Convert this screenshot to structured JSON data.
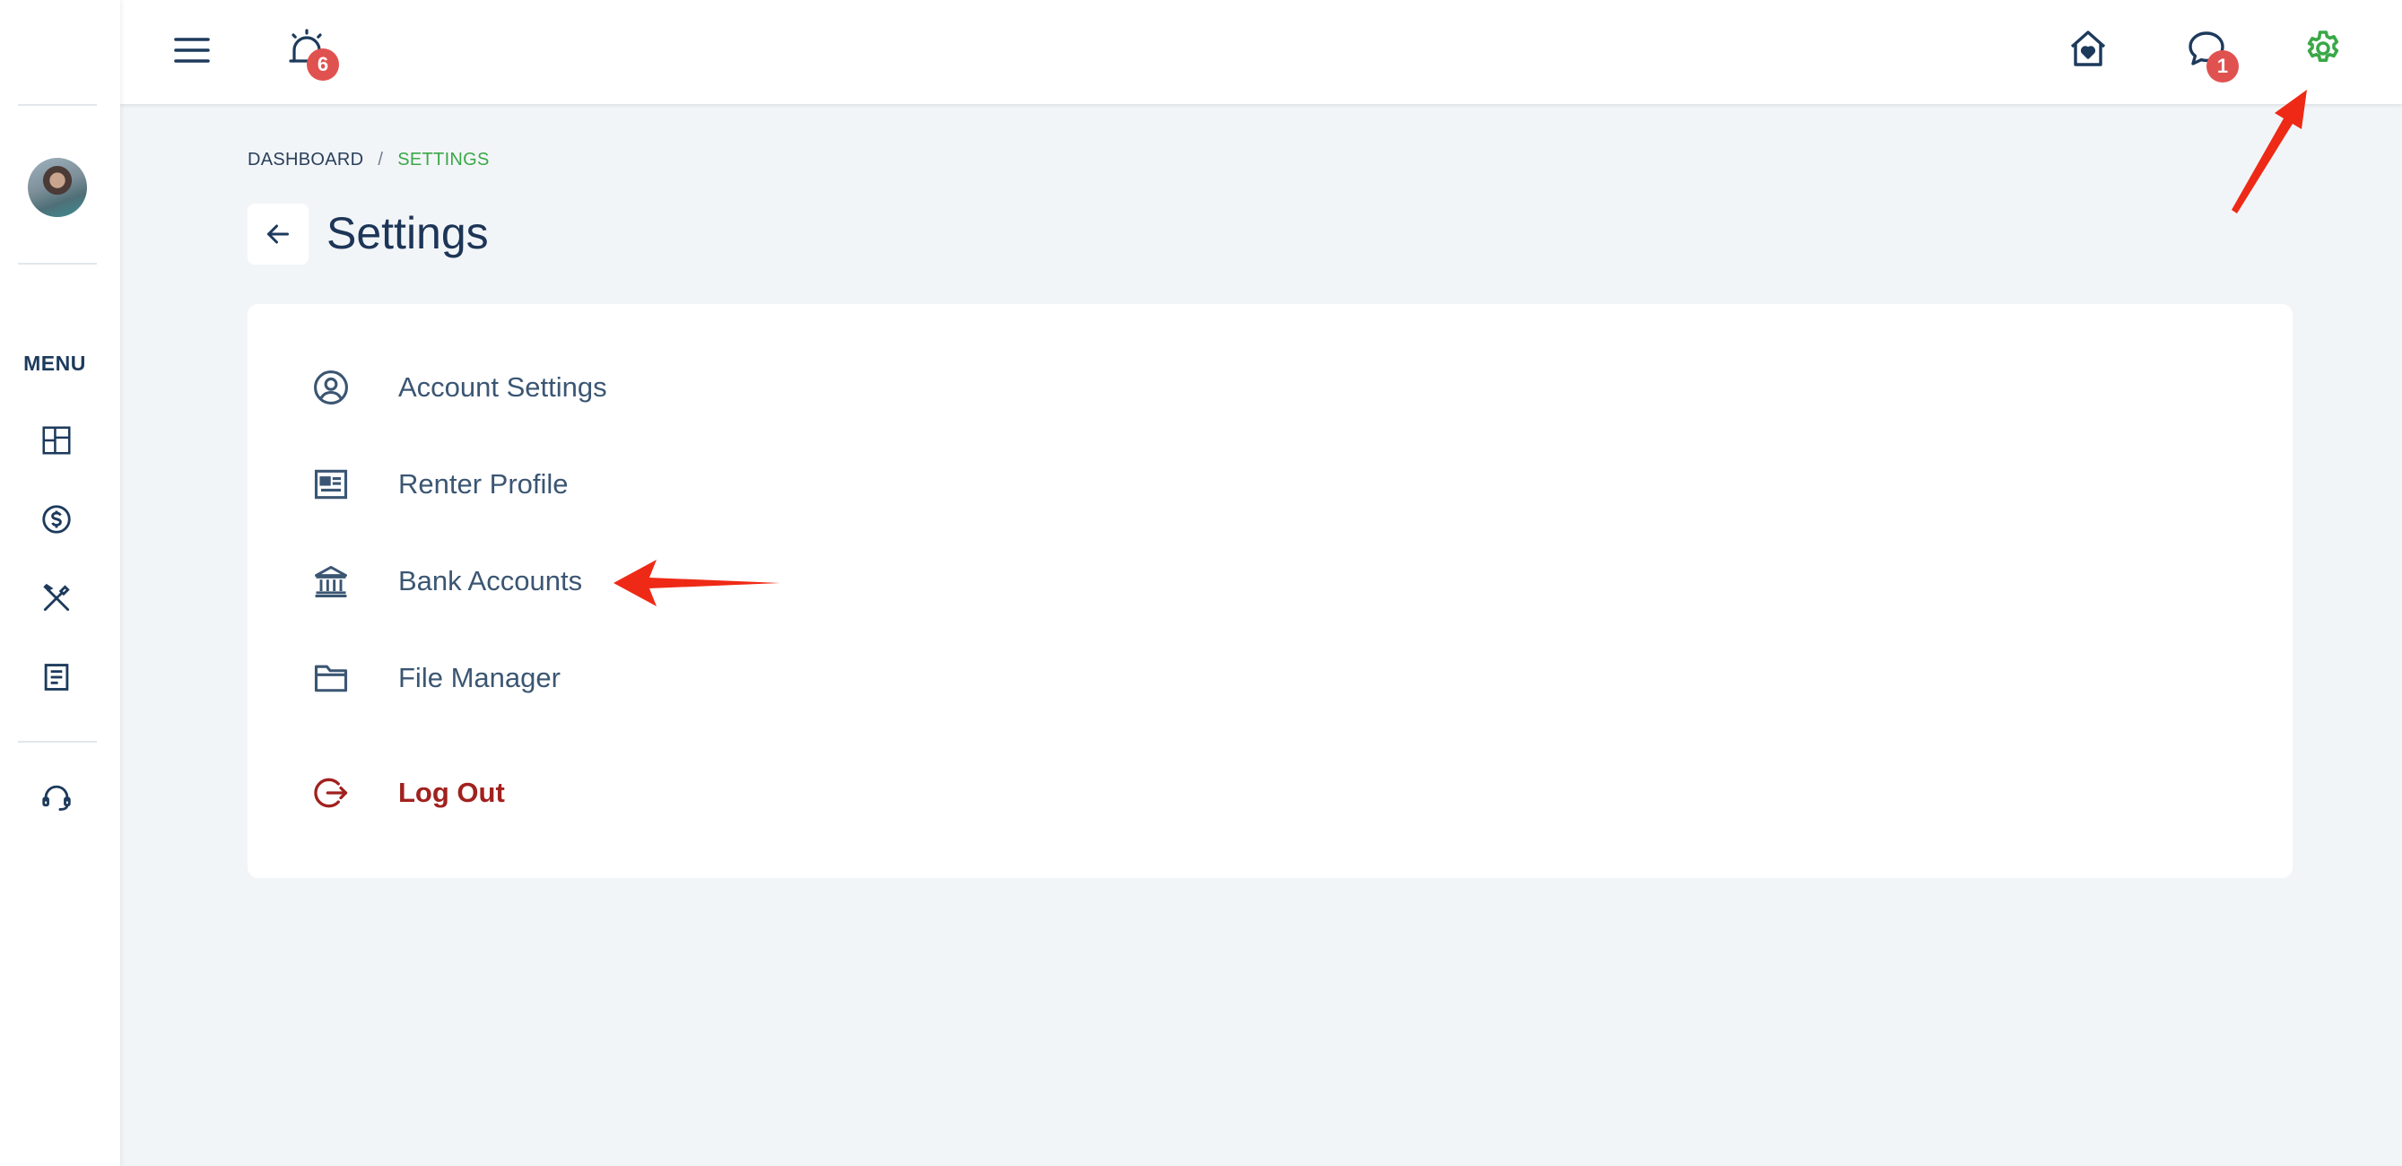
{
  "topbar": {
    "alerts_badge": "6",
    "messages_badge": "1"
  },
  "sidebar": {
    "menu_label": "MENU",
    "items": [
      {
        "icon": "dashboard-icon"
      },
      {
        "icon": "dollar-icon"
      },
      {
        "icon": "tools-icon"
      },
      {
        "icon": "document-icon"
      },
      {
        "icon": "headset-icon"
      }
    ]
  },
  "breadcrumb": {
    "root": "DASHBOARD",
    "separator": "/",
    "current": "SETTINGS"
  },
  "page": {
    "title": "Settings"
  },
  "settings_menu": {
    "items": [
      {
        "label": "Account Settings",
        "icon": "user-circle-icon"
      },
      {
        "label": "Renter Profile",
        "icon": "profile-card-icon"
      },
      {
        "label": "Bank Accounts",
        "icon": "bank-icon"
      },
      {
        "label": "File Manager",
        "icon": "folder-icon"
      }
    ],
    "logout_label": "Log Out"
  },
  "colors": {
    "accent_green": "#3aa847",
    "navy": "#1d3557",
    "badge_red": "#e0524f",
    "logout_red": "#a1211e",
    "annotation_red": "#ee2a16"
  }
}
